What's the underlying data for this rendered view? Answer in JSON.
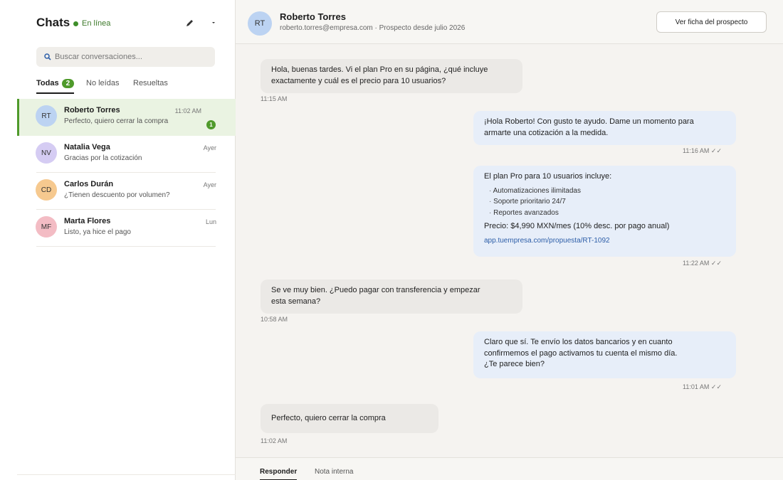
{
  "sidebar": {
    "title": "Chats",
    "status": "En línea",
    "compose_icon": "pencil-icon",
    "menu_icon": "caret-down-icon",
    "search": {
      "placeholder": "Buscar conversaciones..."
    },
    "tabs": [
      {
        "label": "Todas",
        "badge": "2"
      },
      {
        "label": "No leídas"
      },
      {
        "label": "Resueltas"
      }
    ],
    "conversations": [
      {
        "initials": "RT",
        "name": "Roberto Torres",
        "preview": "Perfecto, quiero cerrar la compra",
        "time": "11:02 AM",
        "unread": "1",
        "avatar_color": "#bcd3f2"
      },
      {
        "initials": "NV",
        "name": "Natalia Vega",
        "preview": "Gracias por la cotización",
        "time": "Ayer",
        "avatar_color": "#d5ccf3"
      },
      {
        "initials": "CD",
        "name": "Carlos Durán",
        "preview": "¿Tienen descuento por volumen?",
        "time": "Ayer",
        "avatar_color": "#f6c98f"
      },
      {
        "initials": "MF",
        "name": "Marta Flores",
        "preview": "Listo, ya hice el pago",
        "time": "Lun",
        "avatar_color": "#f3bcc4"
      }
    ]
  },
  "chat": {
    "contact": {
      "initials": "RT",
      "name": "Roberto Torres",
      "meta": "roberto.torres@empresa.com · Prospecto desde julio 2026"
    },
    "profile_button": "Ver ficha del prospecto",
    "messages": [
      {
        "dir": "in",
        "text": "Hola, buenas tardes. Vi el plan Pro en su página, ¿qué incluye\nexactamente y cuál es el precio para 10 usuarios?",
        "time": "11:15 AM"
      },
      {
        "dir": "out",
        "text": "¡Hola Roberto! Con gusto te ayudo. Dame un momento para\narmarte una cotización a la medida.",
        "time": "11:16 AM ✓✓"
      },
      {
        "dir": "out",
        "intro": "El plan Pro para 10 usuarios incluye:",
        "items": [
          "Automatizaciones ilimitadas",
          "Soporte prioritario 24/7",
          "Reportes avanzados"
        ],
        "price": "Precio: $4,990 MXN/mes (10% desc. por pago anual)",
        "link": "app.tuempresa.com/propuesta/RT-1092",
        "time": "11:22 AM ✓✓"
      },
      {
        "dir": "in",
        "text": "Se ve muy bien. ¿Puedo pagar con transferencia y empezar\nesta semana?",
        "time": "10:58 AM"
      },
      {
        "dir": "out",
        "text": "Claro que sí. Te envío los datos bancarios y en cuanto\nconfirmemos el pago activamos tu cuenta el mismo día.\n¿Te parece bien?",
        "time": "11:01 AM ✓✓"
      },
      {
        "dir": "in",
        "text": "Perfecto, quiero cerrar la compra",
        "time": "11:02 AM"
      }
    ],
    "composer_tabs": [
      "Responder",
      "Nota interna"
    ]
  },
  "colors": {
    "accent": "#4f9a2b",
    "incoming_bubble": "#ebe9e6",
    "outgoing_bubble": "#e7eef9",
    "link": "#2d5ea8"
  }
}
